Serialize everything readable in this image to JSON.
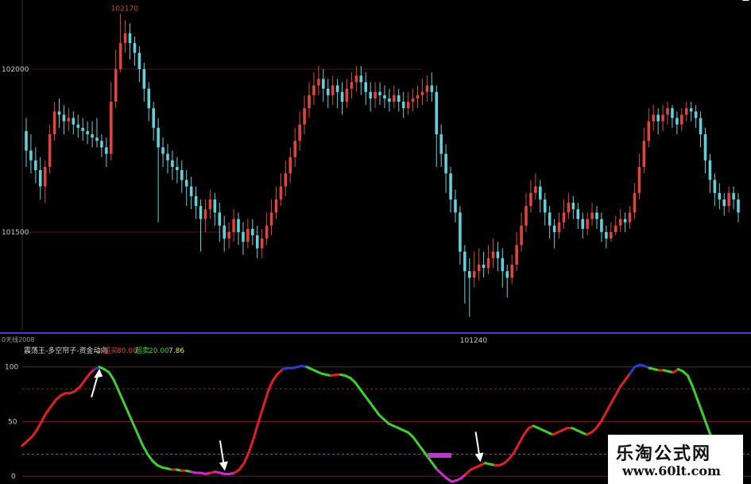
{
  "chart_data": [
    {
      "type": "candlestick",
      "price_high_label": "102170",
      "price_low_label": "101240",
      "y_ticks": [
        "102000",
        "101500"
      ],
      "ylim": [
        101200,
        102200
      ],
      "candles": [
        [
          101810,
          101750,
          101850,
          101700
        ],
        [
          101750,
          101720,
          101800,
          101680
        ],
        [
          101720,
          101690,
          101760,
          101650
        ],
        [
          101690,
          101640,
          101730,
          101600
        ],
        [
          101640,
          101700,
          101720,
          101590
        ],
        [
          101700,
          101800,
          101830,
          101680
        ],
        [
          101800,
          101870,
          101900,
          101780
        ],
        [
          101870,
          101860,
          101910,
          101820
        ],
        [
          101860,
          101840,
          101890,
          101800
        ],
        [
          101840,
          101850,
          101880,
          101810
        ],
        [
          101850,
          101830,
          101870,
          101800
        ],
        [
          101830,
          101820,
          101860,
          101790
        ],
        [
          101820,
          101810,
          101850,
          101780
        ],
        [
          101810,
          101800,
          101840,
          101770
        ],
        [
          101800,
          101790,
          101840,
          101760
        ],
        [
          101790,
          101780,
          101850,
          101760
        ],
        [
          101780,
          101760,
          101800,
          101730
        ],
        [
          101760,
          101740,
          101790,
          101700
        ],
        [
          101740,
          101900,
          101960,
          101720
        ],
        [
          101900,
          102000,
          102060,
          101880
        ],
        [
          102000,
          102080,
          102170,
          101990
        ],
        [
          102080,
          102110,
          102150,
          102050
        ],
        [
          102110,
          102080,
          102140,
          102030
        ],
        [
          102080,
          102050,
          102100,
          102010
        ],
        [
          102050,
          102000,
          102070,
          101960
        ],
        [
          102000,
          101940,
          102020,
          101900
        ],
        [
          101940,
          101880,
          101960,
          101840
        ],
        [
          101880,
          101820,
          101900,
          101780
        ],
        [
          101820,
          101760,
          101850,
          101530
        ],
        [
          101760,
          101740,
          101790,
          101700
        ],
        [
          101740,
          101720,
          101770,
          101680
        ],
        [
          101720,
          101700,
          101750,
          101660
        ],
        [
          101700,
          101690,
          101730,
          101650
        ],
        [
          101690,
          101660,
          101720,
          101620
        ],
        [
          101660,
          101640,
          101690,
          101580
        ],
        [
          101640,
          101610,
          101670,
          101570
        ],
        [
          101610,
          101580,
          101640,
          101540
        ],
        [
          101580,
          101540,
          101600,
          101440
        ],
        [
          101540,
          101570,
          101600,
          101500
        ],
        [
          101570,
          101600,
          101630,
          101540
        ],
        [
          101600,
          101560,
          101620,
          101520
        ],
        [
          101560,
          101520,
          101590,
          101470
        ],
        [
          101520,
          101480,
          101550,
          101440
        ],
        [
          101480,
          101500,
          101530,
          101450
        ],
        [
          101500,
          101540,
          101570,
          101470
        ],
        [
          101540,
          101500,
          101560,
          101460
        ],
        [
          101500,
          101470,
          101530,
          101430
        ],
        [
          101470,
          101510,
          101540,
          101450
        ],
        [
          101510,
          101490,
          101540,
          101460
        ],
        [
          101490,
          101450,
          101520,
          101420
        ],
        [
          101450,
          101480,
          101510,
          101420
        ],
        [
          101480,
          101520,
          101560,
          101460
        ],
        [
          101520,
          101560,
          101600,
          101490
        ],
        [
          101560,
          101600,
          101640,
          101540
        ],
        [
          101600,
          101640,
          101680,
          101580
        ],
        [
          101640,
          101680,
          101720,
          101610
        ],
        [
          101680,
          101730,
          101760,
          101650
        ],
        [
          101730,
          101780,
          101820,
          101700
        ],
        [
          101780,
          101830,
          101870,
          101750
        ],
        [
          101830,
          101880,
          101920,
          101800
        ],
        [
          101880,
          101920,
          101960,
          101850
        ],
        [
          101920,
          101950,
          101990,
          101890
        ],
        [
          101950,
          101970,
          102010,
          101920
        ],
        [
          101970,
          101940,
          102000,
          101900
        ],
        [
          101940,
          101920,
          101970,
          101880
        ],
        [
          101920,
          101950,
          101980,
          101890
        ],
        [
          101950,
          101930,
          101970,
          101880
        ],
        [
          101930,
          101900,
          101960,
          101860
        ],
        [
          101900,
          101940,
          101970,
          101880
        ],
        [
          101940,
          101960,
          101990,
          101910
        ],
        [
          101960,
          101980,
          102010,
          101930
        ],
        [
          101980,
          101960,
          102010,
          101920
        ],
        [
          101960,
          101930,
          101990,
          101890
        ],
        [
          101930,
          101910,
          101960,
          101870
        ],
        [
          101910,
          101930,
          101960,
          101880
        ],
        [
          101930,
          101920,
          101960,
          101890
        ],
        [
          101920,
          101910,
          101950,
          101880
        ],
        [
          101910,
          101900,
          101940,
          101870
        ],
        [
          101900,
          101920,
          101950,
          101880
        ],
        [
          101920,
          101900,
          101940,
          101870
        ],
        [
          101900,
          101880,
          101930,
          101850
        ],
        [
          101880,
          101900,
          101930,
          101860
        ],
        [
          101900,
          101910,
          101940,
          101870
        ],
        [
          101910,
          101920,
          101950,
          101880
        ],
        [
          101920,
          101930,
          101970,
          101890
        ],
        [
          101930,
          101950,
          101980,
          101900
        ],
        [
          101950,
          101930,
          101990,
          101900
        ],
        [
          101930,
          101800,
          101950,
          101700
        ],
        [
          101800,
          101740,
          101830,
          101700
        ],
        [
          101740,
          101680,
          101770,
          101620
        ],
        [
          101680,
          101600,
          101700,
          101560
        ],
        [
          101600,
          101560,
          101630,
          101530
        ],
        [
          101560,
          101440,
          101580,
          101400
        ],
        [
          101440,
          101380,
          101460,
          101280
        ],
        [
          101380,
          101360,
          101420,
          101240
        ],
        [
          101360,
          101380,
          101440,
          101330
        ],
        [
          101380,
          101400,
          101450,
          101350
        ],
        [
          101400,
          101390,
          101440,
          101360
        ],
        [
          101390,
          101420,
          101460,
          101370
        ],
        [
          101420,
          101440,
          101480,
          101390
        ],
        [
          101440,
          101420,
          101470,
          101380
        ],
        [
          101420,
          101380,
          101450,
          101330
        ],
        [
          101380,
          101360,
          101400,
          101300
        ],
        [
          101360,
          101400,
          101430,
          101340
        ],
        [
          101400,
          101460,
          101500,
          101380
        ],
        [
          101460,
          101520,
          101560,
          101440
        ],
        [
          101520,
          101580,
          101620,
          101500
        ],
        [
          101580,
          101620,
          101660,
          101560
        ],
        [
          101620,
          101640,
          101680,
          101600
        ],
        [
          101640,
          101600,
          101660,
          101560
        ],
        [
          101600,
          101560,
          101620,
          101520
        ],
        [
          101560,
          101520,
          101580,
          101480
        ],
        [
          101520,
          101500,
          101540,
          101450
        ],
        [
          101500,
          101530,
          101560,
          101480
        ],
        [
          101530,
          101560,
          101600,
          101510
        ],
        [
          101560,
          101590,
          101620,
          101540
        ],
        [
          101590,
          101570,
          101610,
          101540
        ],
        [
          101570,
          101540,
          101590,
          101510
        ],
        [
          101540,
          101510,
          101560,
          101480
        ],
        [
          101510,
          101540,
          101560,
          101490
        ],
        [
          101540,
          101560,
          101590,
          101520
        ],
        [
          101560,
          101540,
          101580,
          101510
        ],
        [
          101540,
          101500,
          101560,
          101470
        ],
        [
          101500,
          101480,
          101520,
          101450
        ],
        [
          101480,
          101500,
          101530,
          101470
        ],
        [
          101500,
          101520,
          101550,
          101490
        ],
        [
          101520,
          101540,
          101570,
          101500
        ],
        [
          101540,
          101530,
          101560,
          101500
        ],
        [
          101530,
          101560,
          101580,
          101510
        ],
        [
          101560,
          101620,
          101650,
          101540
        ],
        [
          101620,
          101700,
          101740,
          101600
        ],
        [
          101700,
          101780,
          101820,
          101680
        ],
        [
          101780,
          101840,
          101880,
          101760
        ],
        [
          101840,
          101860,
          101890,
          101810
        ],
        [
          101860,
          101840,
          101880,
          101800
        ],
        [
          101840,
          101860,
          101890,
          101810
        ],
        [
          101860,
          101880,
          101900,
          101830
        ],
        [
          101880,
          101850,
          101890,
          101820
        ],
        [
          101850,
          101830,
          101870,
          101800
        ],
        [
          101830,
          101860,
          101880,
          101810
        ],
        [
          101860,
          101880,
          101900,
          101840
        ],
        [
          101880,
          101870,
          101900,
          101840
        ],
        [
          101870,
          101850,
          101890,
          101820
        ],
        [
          101850,
          101800,
          101870,
          101760
        ],
        [
          101800,
          101720,
          101820,
          101680
        ],
        [
          101720,
          101660,
          101740,
          101620
        ],
        [
          101660,
          101620,
          101680,
          101580
        ],
        [
          101620,
          101600,
          101650,
          101570
        ],
        [
          101600,
          101580,
          101620,
          101550
        ],
        [
          101580,
          101620,
          101640,
          101560
        ],
        [
          101620,
          101600,
          101640,
          101570
        ],
        [
          101600,
          101560,
          101620,
          101530
        ]
      ]
    },
    {
      "type": "line",
      "indicator_code": "0天线2008",
      "legend": {
        "name": "震荡王-多空帘子-资金动向",
        "overbought_label": "超买",
        "overbought_value": "80.00",
        "oversold_label": "超卖",
        "oversold_value": "20.00",
        "current_value": "7.86"
      },
      "y_ticks": [
        "100",
        "50",
        "0"
      ],
      "ylim": [
        -5,
        110
      ],
      "reference_levels": [
        100,
        80,
        50,
        20,
        0
      ],
      "series_values": [
        28,
        32,
        36,
        42,
        50,
        58,
        64,
        70,
        74,
        76,
        76,
        78,
        82,
        88,
        94,
        98,
        100,
        98,
        95,
        88,
        78,
        68,
        58,
        48,
        38,
        28,
        20,
        14,
        10,
        8,
        7,
        6,
        6,
        5,
        5,
        4,
        3,
        3,
        2,
        3,
        4,
        3,
        2,
        2,
        3,
        6,
        12,
        22,
        35,
        50,
        64,
        78,
        88,
        94,
        98,
        99,
        99,
        100,
        101,
        100,
        98,
        96,
        94,
        93,
        92,
        93,
        93,
        92,
        90,
        86,
        80,
        74,
        68,
        62,
        56,
        52,
        48,
        46,
        44,
        42,
        40,
        36,
        30,
        24,
        18,
        12,
        6,
        2,
        -2,
        -5,
        -4,
        -2,
        2,
        6,
        8,
        10,
        12,
        11,
        10,
        10,
        12,
        16,
        22,
        30,
        38,
        44,
        46,
        44,
        42,
        40,
        38,
        40,
        42,
        44,
        44,
        42,
        40,
        38,
        40,
        44,
        50,
        58,
        66,
        74,
        82,
        88,
        94,
        100,
        102,
        101,
        99,
        98,
        97,
        97,
        96,
        95,
        98,
        96,
        92,
        82,
        70,
        58,
        46,
        34,
        22,
        12
      ],
      "arrows_at": [
        16,
        42,
        95,
        151
      ]
    }
  ],
  "colors": {
    "background": "#000000",
    "up_candle": "#e0443c",
    "down_candle": "#5fd3dc",
    "indicator_up": "#e02020",
    "indicator_down": "#3ecf2e",
    "indicator_peak": "#2a3ccf",
    "indicator_trough": "#cf2acf",
    "divider": "#5533cc",
    "ref_red": "#8a1a1a",
    "ref_green": "#1a8a1a"
  },
  "watermark": {
    "title": "乐淘公式网",
    "url": "www.60lt.com"
  }
}
